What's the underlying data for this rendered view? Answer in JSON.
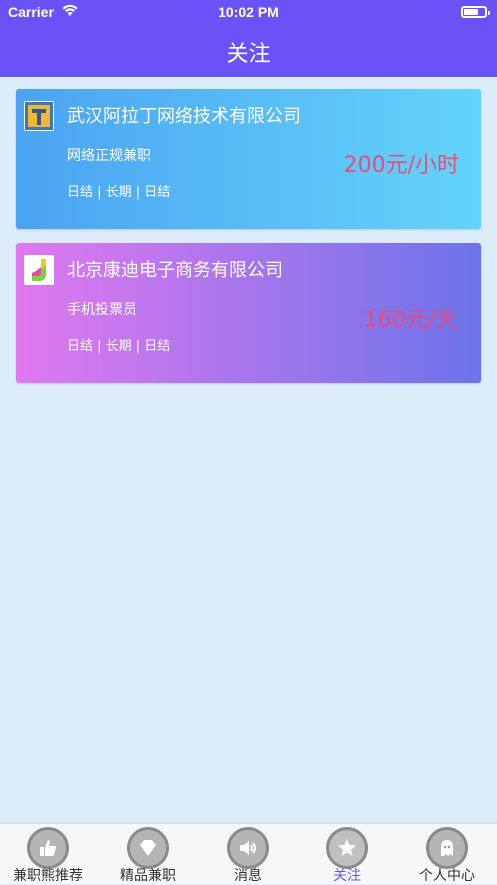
{
  "status_bar": {
    "carrier": "Carrier",
    "time": "10:02 PM"
  },
  "header": {
    "title": "关注"
  },
  "cards": [
    {
      "company": "武汉阿拉丁网络技术有限公司",
      "job": "网络正规兼职",
      "tags": "日结 | 长期 | 日结",
      "pay": "200元/小时"
    },
    {
      "company": "北京康迪电子商务有限公司",
      "job": "手机投票员",
      "tags": "日结 | 长期 | 日结",
      "pay": "160元/天"
    }
  ],
  "tabbar": {
    "tabs": [
      {
        "label": "兼职熊推荐",
        "icon": "thumbs-up-icon"
      },
      {
        "label": "精品兼职",
        "icon": "diamond-icon"
      },
      {
        "label": "消息",
        "icon": "speaker-icon"
      },
      {
        "label": "关注",
        "icon": "star-icon",
        "active": true
      },
      {
        "label": "个人中心",
        "icon": "ghost-icon"
      }
    ]
  },
  "colors": {
    "header_bg": "#6b52f6",
    "pay_text": "#ec4a7a",
    "active_tab": "#6b52f6"
  }
}
